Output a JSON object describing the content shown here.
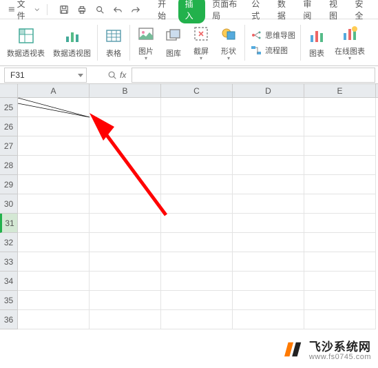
{
  "menubar": {
    "file": "文件",
    "tabs": [
      "开始",
      "插入",
      "页面布局",
      "公式",
      "数据",
      "审阅",
      "视图",
      "安全"
    ],
    "active_tab": 1
  },
  "ribbon": {
    "items": [
      {
        "label": "数据透视表",
        "icon": "pivot-table"
      },
      {
        "label": "数据透视图",
        "icon": "pivot-chart"
      },
      {
        "label": "表格",
        "icon": "table"
      },
      {
        "label": "图片",
        "icon": "picture",
        "dd": true
      },
      {
        "label": "图库",
        "icon": "gallery"
      },
      {
        "label": "截屏",
        "icon": "screenshot",
        "dd": true
      },
      {
        "label": "形状",
        "icon": "shapes",
        "dd": true
      },
      {
        "label": "思维导图",
        "icon": "mindmap",
        "upper": true
      },
      {
        "label": "流程图",
        "icon": "flowchart",
        "upper": true
      },
      {
        "label": "图表",
        "icon": "chart"
      },
      {
        "label": "在线图表",
        "icon": "online-chart",
        "dd": true
      }
    ]
  },
  "namebox": "F31",
  "fx_label": "fx",
  "columns": [
    "A",
    "B",
    "C",
    "D",
    "E"
  ],
  "rows": [
    25,
    26,
    27,
    28,
    29,
    30,
    31,
    32,
    33,
    34,
    35,
    36
  ],
  "selected_row": 31,
  "watermark": {
    "title": "飞沙系统网",
    "url": "www.fs0745.com"
  }
}
